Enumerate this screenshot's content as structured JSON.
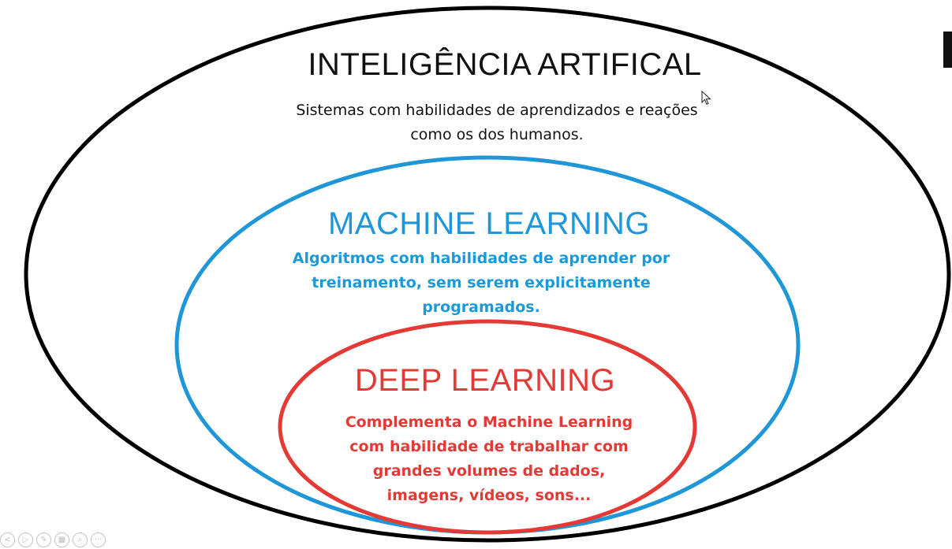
{
  "diagram": {
    "ai": {
      "title": "INTELIGÊNCIA ARTIFICAL",
      "description": [
        "Sistemas com habilidades de aprendizados e reações",
        "como os dos humanos."
      ],
      "color": "#111111"
    },
    "ml": {
      "title": "MACHINE LEARNING",
      "description": [
        "Algoritmos com habilidades de aprender por",
        "treinamento, sem serem explicitamente",
        "programados."
      ],
      "color": "#1e96d8"
    },
    "dl": {
      "title": "DEEP LEARNING",
      "description": [
        "Complementa o Machine Learning",
        "com habilidade de trabalhar com",
        "grandes volumes de dados,",
        "imagens, vídeos, sons..."
      ],
      "color": "#e43a36"
    }
  },
  "controls": {
    "icons": [
      "previous-icon",
      "play-icon",
      "pen-icon",
      "slides-icon",
      "zoom-icon",
      "more-icon"
    ],
    "glyphs": [
      "<",
      "▷",
      "✎",
      "▦",
      "⌕",
      "···"
    ]
  }
}
